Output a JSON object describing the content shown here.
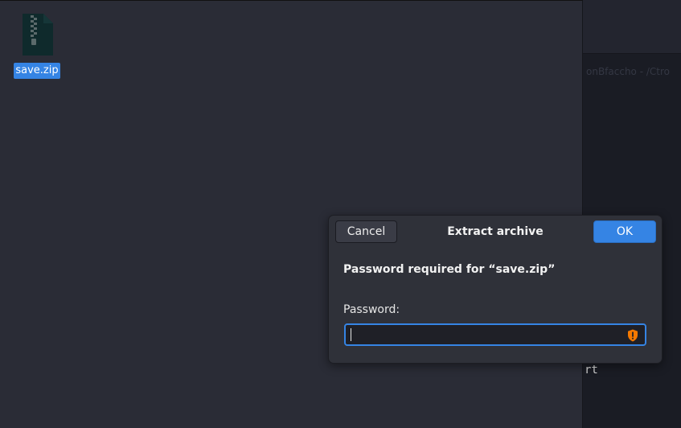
{
  "desktop": {
    "file_icon": {
      "icon": "zip-archive-icon",
      "label": "save.zip"
    }
  },
  "background_window": {
    "faint_text": "onBfaccho - /Ctro",
    "terminal_fragment": "rt"
  },
  "dialog": {
    "title": "Extract archive",
    "cancel_label": "Cancel",
    "ok_label": "OK",
    "prompt": "Password required for “save.zip”",
    "password_label": "Password:",
    "password_value": "",
    "warning_icon": "shield-warning-icon"
  },
  "colors": {
    "accent": "#3584e4",
    "warning": "#f57900",
    "window_bg": "#2a2c36",
    "dialog_bg": "#2f3139"
  }
}
